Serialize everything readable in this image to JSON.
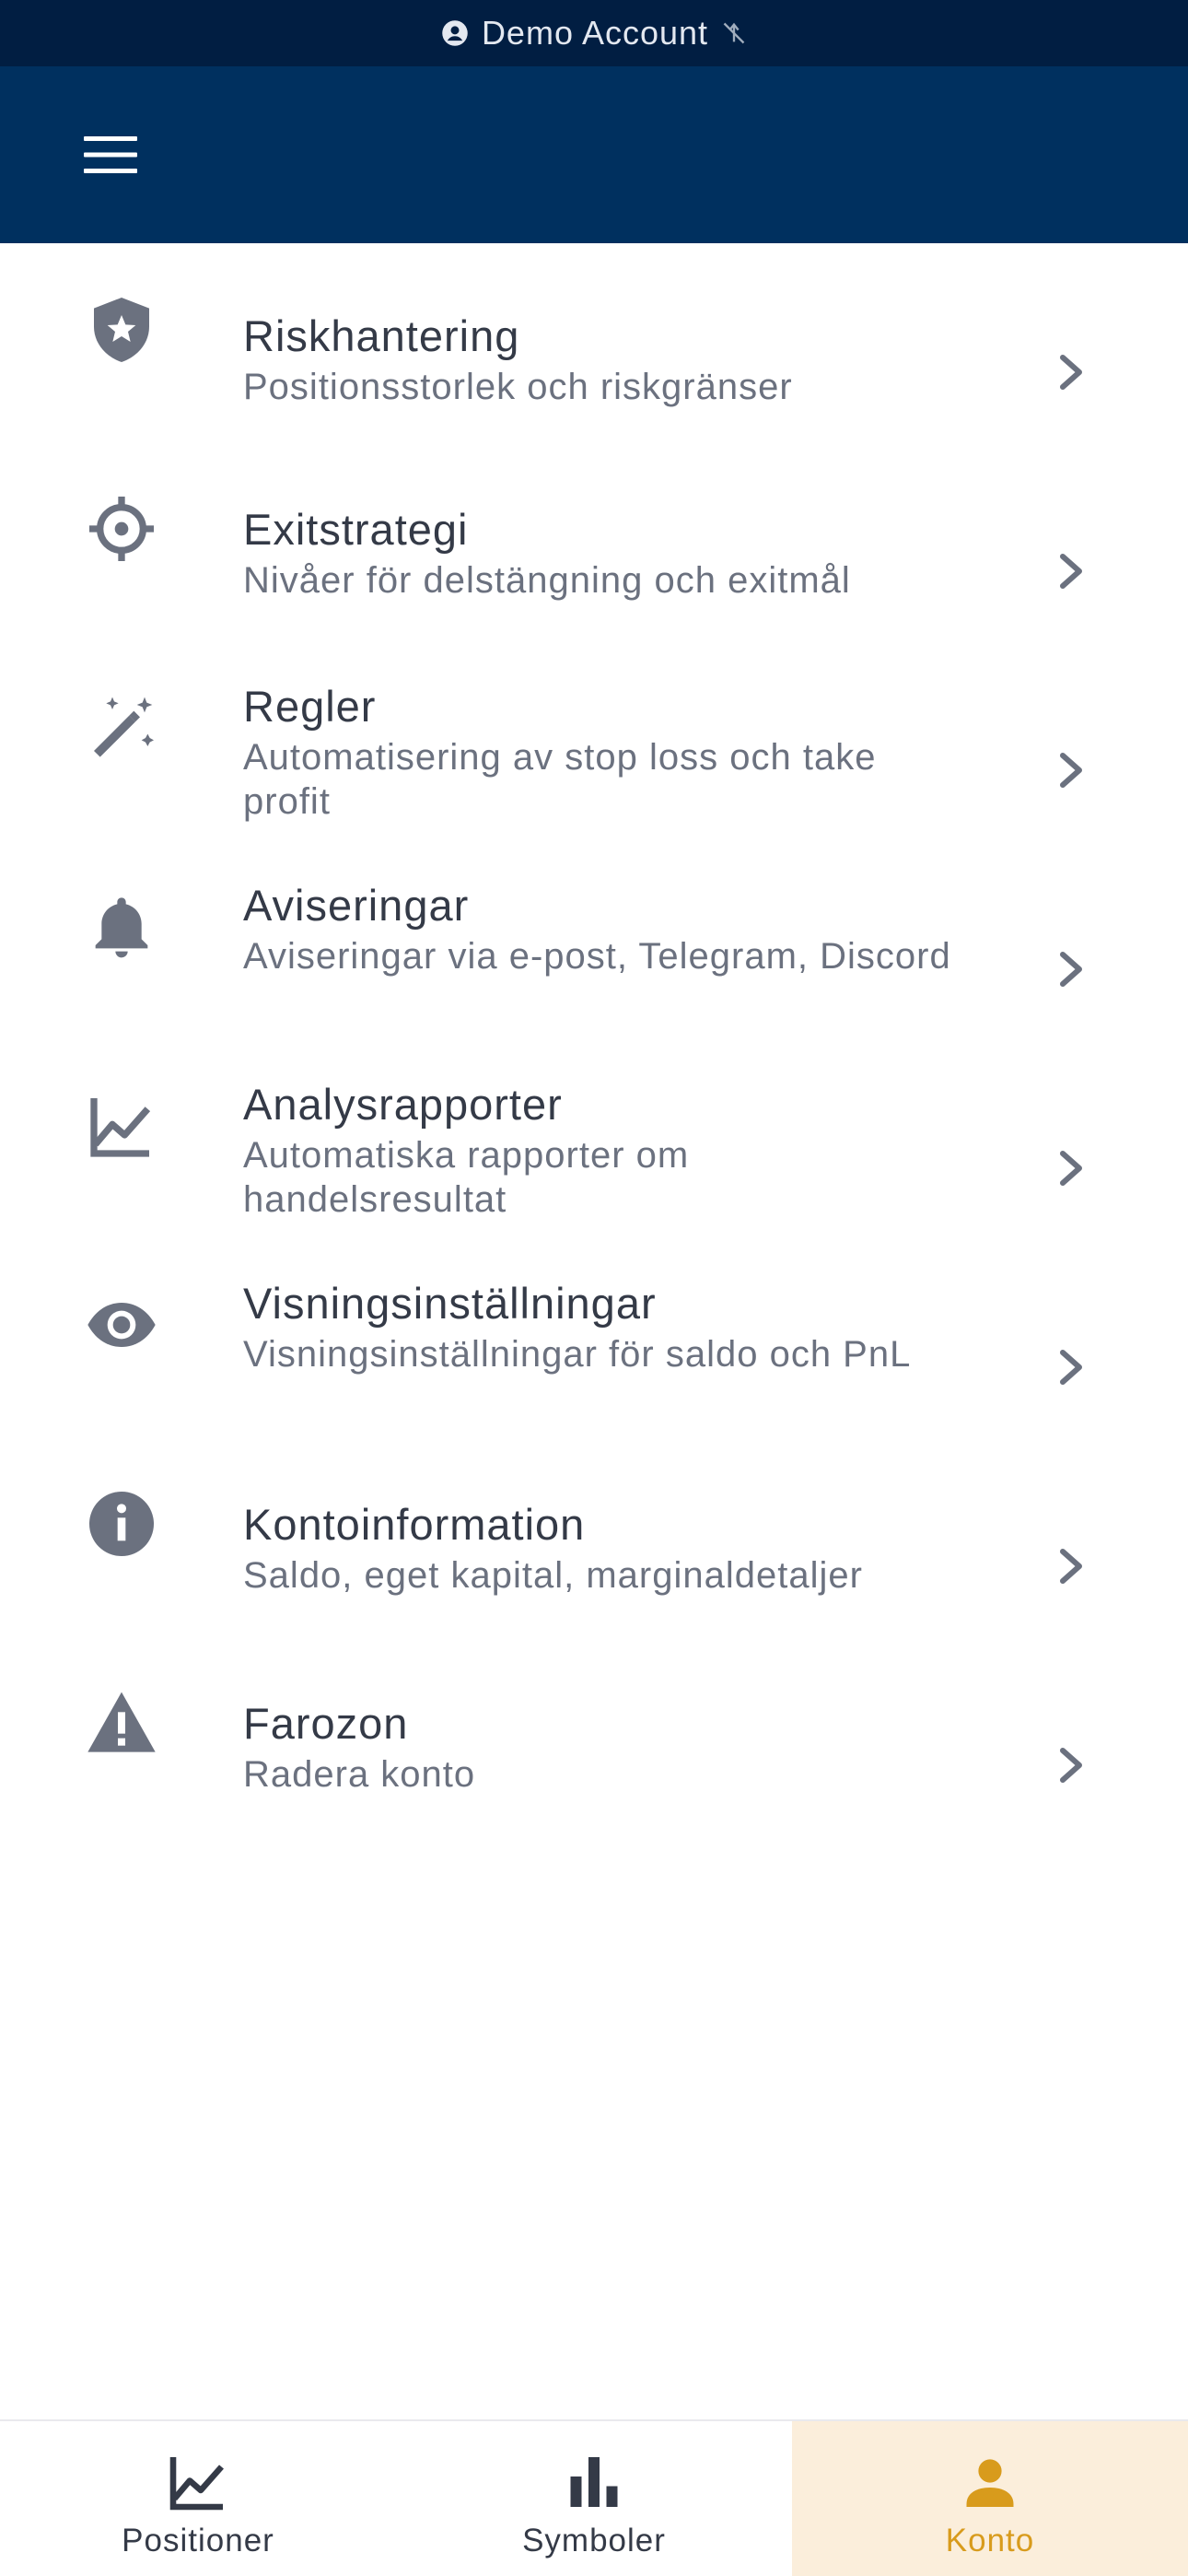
{
  "status_bar": {
    "account_label": "Demo Account",
    "icons": [
      "account-circle-icon",
      "wifi-off-icon"
    ]
  },
  "app_bar": {
    "menu_icon": "hamburger-menu-icon",
    "background": "#00305f"
  },
  "settings": {
    "items": [
      {
        "title": "Riskhantering",
        "subtitle": "Positionsstorlek och riskgränser",
        "icon": "shield-star-icon"
      },
      {
        "title": "Exitstrategi",
        "subtitle": "Nivåer för delstängning och exitmål",
        "icon": "crosshair-icon"
      },
      {
        "title": "Regler",
        "subtitle": "Automatisering av stop loss och take profit",
        "icon": "magic-wand-icon"
      },
      {
        "title": "Aviseringar",
        "subtitle": "Aviseringar via e-post, Telegram, Discord",
        "icon": "bell-icon"
      },
      {
        "title": "Analysrapporter",
        "subtitle": "Automatiska rapporter om handelsresultat",
        "icon": "line-chart-icon"
      },
      {
        "title": "Visningsinställningar",
        "subtitle": "Visningsinställningar för saldo och PnL",
        "icon": "eye-icon"
      },
      {
        "title": "Kontoinformation",
        "subtitle": "Saldo, eget kapital, marginaldetaljer",
        "icon": "info-icon"
      },
      {
        "title": "Farozon",
        "subtitle": "Radera konto",
        "icon": "warning-icon"
      }
    ]
  },
  "bottom_nav": {
    "tabs": [
      {
        "label": "Positioner",
        "icon": "line-chart-icon"
      },
      {
        "label": "Symboler",
        "icon": "bar-chart-icon"
      },
      {
        "label": "Konto",
        "icon": "person-icon",
        "active": true
      }
    ],
    "active_color": "#d89b1c",
    "active_background": "#fbeedb"
  },
  "colors": {
    "status_bar": "#011e42",
    "icon_gray": "#6b717f",
    "title_text": "#343a47"
  }
}
